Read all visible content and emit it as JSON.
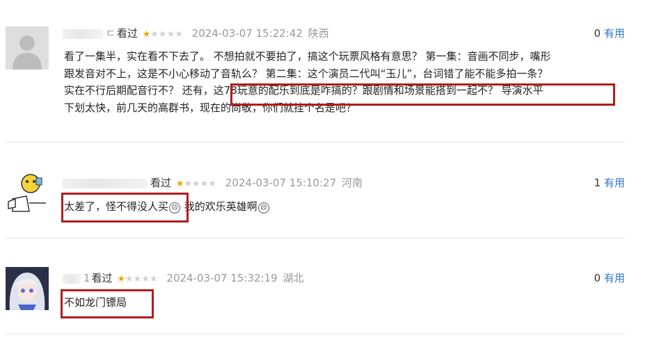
{
  "reviews": [
    {
      "username_fragment": "ㄷ",
      "watched": "看过",
      "rating": 1,
      "time": "2024-03-07 15:22:42",
      "location": "陕西",
      "useful_count": "0",
      "useful_label": "有用",
      "lines": [
        "看了一集半，实在看不下去了。 不想拍就不要拍了，搞这个玩票风格有意思？ 第一集：音画不同步，嘴形",
        "跟发音对不上，这是不小心移动了音轨么？ 第二集：这个演员二代叫“玉儿”，台词错了能不能多拍一条？",
        "实在不行后期配音行不？ 还有，这78玩意的配乐到底是咋搞的？跟剧情和场景能搭到一起不？ 导演水平",
        "下划太快，前几天的高群书，现在的尚敬，你们就挂个名是吧？"
      ]
    },
    {
      "username_fragment": "",
      "watched": "看过",
      "rating": 1,
      "time": "2024-03-07 15:10:27",
      "location": "河南",
      "useful_count": "1",
      "useful_label": "有用",
      "text_main": "太差了，怪不得没人买",
      "emoji1": "☹",
      "text_tail": " 我的欢乐英雄啊",
      "emoji2": "☹"
    },
    {
      "username_fragment": "1",
      "watched": "看过",
      "rating": 1,
      "time": "2024-03-07 15:32:19",
      "location": "湖北",
      "useful_count": "0",
      "useful_label": "有用",
      "text_main": "不如龙门镖局"
    }
  ],
  "icons": {
    "star": "star-icon",
    "default_avatar": "default-avatar-icon"
  },
  "colors": {
    "link": "#2a78c8",
    "star": "#f5a300",
    "highlight": "#b11c1c"
  }
}
